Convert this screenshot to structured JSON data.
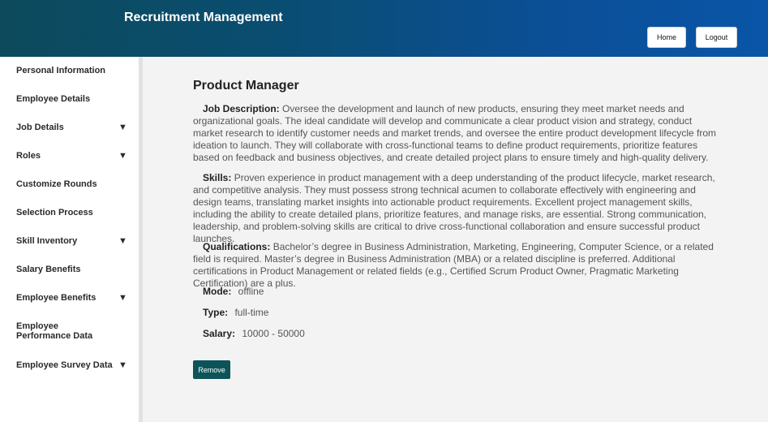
{
  "header": {
    "title": "Recruitment Management",
    "home_label": "Home",
    "logout_label": "Logout"
  },
  "sidebar": {
    "items": [
      {
        "label": "Personal Information",
        "has_dropdown": false
      },
      {
        "label": "Employee Details",
        "has_dropdown": false
      },
      {
        "label": "Job Details",
        "has_dropdown": true
      },
      {
        "label": "Roles",
        "has_dropdown": true
      },
      {
        "label": "Customize Rounds",
        "has_dropdown": false
      },
      {
        "label": "Selection Process",
        "has_dropdown": false
      },
      {
        "label": "Skill Inventory",
        "has_dropdown": true
      },
      {
        "label": "Salary Benefits",
        "has_dropdown": false
      },
      {
        "label": "Employee Benefits",
        "has_dropdown": true
      },
      {
        "label": "Employee Performance Data",
        "has_dropdown": false
      },
      {
        "label": "Employee Survey Data",
        "has_dropdown": true
      }
    ],
    "chevron_glyph": "▼"
  },
  "job": {
    "title": "Product Manager",
    "description_label": "Job Description:",
    "description": "Oversee the development and launch of new products, ensuring they meet market needs and organizational goals. The ideal candidate will develop and communicate a clear product vision and strategy, conduct market research to identify customer needs and market trends, and oversee the entire product development lifecycle from ideation to launch. They will collaborate with cross-functional teams to define product requirements, prioritize features based on feedback and business objectives, and create detailed project plans to ensure timely and high-quality delivery.",
    "skills_label": "Skills:",
    "skills": "Proven experience in product management with a deep understanding of the product lifecycle, market research, and competitive analysis. They must possess strong technical acumen to collaborate effectively with engineering and design teams, translating market insights into actionable product requirements. Excellent project management skills, including the ability to create detailed plans, prioritize features, and manage risks, are essential. Strong communication, leadership, and problem-solving skills are critical to drive cross-functional collaboration and ensure successful product launches.",
    "qualifications_label": "Qualifications:",
    "qualifications": "Bachelor’s degree in Business Administration, Marketing, Engineering, Computer Science, or a related field is required. Master’s degree in Business Administration (MBA) or a related discipline is preferred. Additional certifications in Product Management or related fields (e.g., Certified Scrum Product Owner, Pragmatic Marketing Certification) are a plus.",
    "mode_label": "Mode:",
    "mode": "offline",
    "type_label": "Type:",
    "type": "full-time",
    "salary_label": "Salary:",
    "salary": "10000 - 50000",
    "remove_label": "Remove"
  },
  "colors": {
    "header_start": "#0c4a5c",
    "header_end": "#0a55a8",
    "remove_button": "#0d5458",
    "content_bg": "#f3f3f3"
  }
}
